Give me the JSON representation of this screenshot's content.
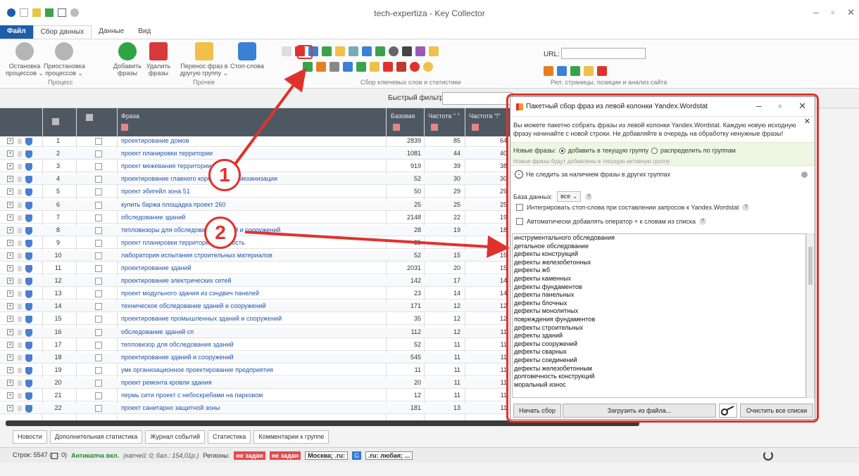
{
  "window": {
    "title": "tech-expertiza - Key Collector",
    "controls": [
      "–",
      "▫",
      "✕"
    ]
  },
  "ribbon_tabs": [
    "Файл",
    "Сбор данных",
    "Данные",
    "Вид"
  ],
  "ribbon": {
    "buttons": [
      {
        "label": "Остановка процессов ⌄",
        "color": "#b5b5b5"
      },
      {
        "label": "Приостановка процессов ⌄",
        "color": "#b5b5b5"
      },
      {
        "label": "Добавить фразы",
        "color": "#2fa447"
      },
      {
        "label": "Удалить фразы",
        "color": "#d63a3a"
      },
      {
        "label": "Перенос фраз в другую группу ⌄",
        "color": "#f0c04a"
      },
      {
        "label": "Стоп-слова",
        "color": "#3c7fd6"
      }
    ],
    "group_labels": [
      "Процесс",
      "Прочее",
      "Сбор ключевых слов и статистики",
      "Рел. страницы, позиции и анализ сайта"
    ],
    "url_label": "URL:"
  },
  "filter": {
    "label": "Быстрый фильтр:",
    "value": ""
  },
  "grid": {
    "headers": {
      "phrase": "Фраза",
      "base": "Базовая",
      "freq_quoted": "Частота \" \"",
      "freq_excl": "Частота \"!\""
    },
    "rows": [
      {
        "n": "1",
        "phrase": "проектирование домов",
        "base": "2839",
        "q": "85",
        "e": "64"
      },
      {
        "n": "2",
        "phrase": "проект планировки территории",
        "base": "1081",
        "q": "44",
        "e": "40"
      },
      {
        "n": "3",
        "phrase": "проект межевания территории",
        "base": "919",
        "q": "39",
        "e": "38"
      },
      {
        "n": "4",
        "phrase": "проектирование главного корпуса базы механизации",
        "base": "52",
        "q": "30",
        "e": "30"
      },
      {
        "n": "5",
        "phrase": "проект эбигейл зона 51",
        "base": "50",
        "q": "29",
        "e": "29"
      },
      {
        "n": "6",
        "phrase": "купить баржа площадка проект 260",
        "base": "25",
        "q": "25",
        "e": "25"
      },
      {
        "n": "7",
        "phrase": "обследование зданий",
        "base": "2148",
        "q": "22",
        "e": "19"
      },
      {
        "n": "8",
        "phrase": "тепловизоры для обследования зданий и сооружений",
        "base": "28",
        "q": "19",
        "e": "18"
      },
      {
        "n": "9",
        "phrase": "проект планировки территории стоимость",
        "base": "25",
        "q": "",
        "e": ""
      },
      {
        "n": "10",
        "phrase": "лаборатория испытания строительных материалов",
        "base": "52",
        "q": "15",
        "e": "15"
      },
      {
        "n": "11",
        "phrase": "проектирование зданий",
        "base": "2031",
        "q": "20",
        "e": "15"
      },
      {
        "n": "12",
        "phrase": "проектирование электрических сетей",
        "base": "142",
        "q": "17",
        "e": "14"
      },
      {
        "n": "13",
        "phrase": "проект модульного здания из сэндвич панелей",
        "base": "23",
        "q": "14",
        "e": "14"
      },
      {
        "n": "14",
        "phrase": "техническое обследование зданий и сооружений",
        "base": "171",
        "q": "12",
        "e": "12"
      },
      {
        "n": "15",
        "phrase": "проектирование промышленных зданий и сооружений",
        "base": "35",
        "q": "12",
        "e": "12"
      },
      {
        "n": "16",
        "phrase": "обследование зданий сп",
        "base": "112",
        "q": "12",
        "e": "11"
      },
      {
        "n": "17",
        "phrase": "тепловизор для обследования зданий",
        "base": "52",
        "q": "11",
        "e": "11"
      },
      {
        "n": "18",
        "phrase": "проектирование зданий и сооружений",
        "base": "545",
        "q": "11",
        "e": "11"
      },
      {
        "n": "19",
        "phrase": "умк организационное проектирование предприятия",
        "base": "11",
        "q": "11",
        "e": "11"
      },
      {
        "n": "20",
        "phrase": "проект ремонта кровли здания",
        "base": "20",
        "q": "11",
        "e": "11"
      },
      {
        "n": "21",
        "phrase": "пермь сити проект с небоскребами на парковом",
        "base": "12",
        "q": "11",
        "e": "11"
      },
      {
        "n": "22",
        "phrase": "проект санитарно защитной зоны",
        "base": "181",
        "q": "13",
        "e": "11"
      }
    ]
  },
  "bottom_tabs": [
    "Новости",
    "Дополнительная статистика",
    "Журнал событий",
    "Статистика",
    "Комментарии к группе"
  ],
  "status": {
    "rows": "Строк: 5547 (",
    "rows_sel": ": 0)",
    "anticaptcha": "Антикапча вкл.",
    "balance": "(капчей: 0; бал.: 154,01р.)",
    "regions": "Регионы:",
    "region1": "не задан",
    "region2": "не задан",
    "region3": "Москва; .ru:",
    "region4": ".ru: любая; ..."
  },
  "dialog": {
    "title": "Пакетный сбор фраз из левой колонки Yandex.Wordstat",
    "info": "Вы можете пакетно собрать фразы из левой колонки Yandex.Wordstat. Каждую новую исходную фразу начинайте с новой строки. Не добавляйте в очередь на обработку ненужные фразы!",
    "new_phrases_label": "Новые фразы:",
    "opt_current": "добавить в текущую группу",
    "opt_distribute": "распределить по группам",
    "hint": "Новые фразы будут добавлены в текущую активную группу.",
    "no_track": "Не следить за наличием фразы в других группах",
    "db_label": "База данных:",
    "db_value": "все",
    "chk_stopwords": "Интегрировать стоп-слова при составлении запросов к Yandex.Wordstat",
    "chk_plus": "Автоматически добавлять оператор + к словам из списка",
    "lines": [
      "инструментального обследования",
      "детальное обследование",
      "дефекты конструкций",
      "дефекты железобетонных",
      "дефекты жб",
      "дефекты каменных",
      "дефекты фундаментов",
      "дефекты панельных",
      "дефекты блочных",
      "дефекты монолитных",
      "повреждения фундаментов",
      "дефекты строительных",
      "дефекты зданий",
      "дефекты сооружений",
      "дефекты сварных",
      "дефекты соединений",
      "дефекты железобетонным",
      "долговечность конструкций",
      "моральный износ"
    ],
    "btn_start": "Начать сбор",
    "btn_load": "Загрузить из файла...",
    "btn_clear": "Очистить все списки"
  },
  "annotations": {
    "marker1": "1",
    "marker2": "2",
    "color": "#e0322d"
  }
}
